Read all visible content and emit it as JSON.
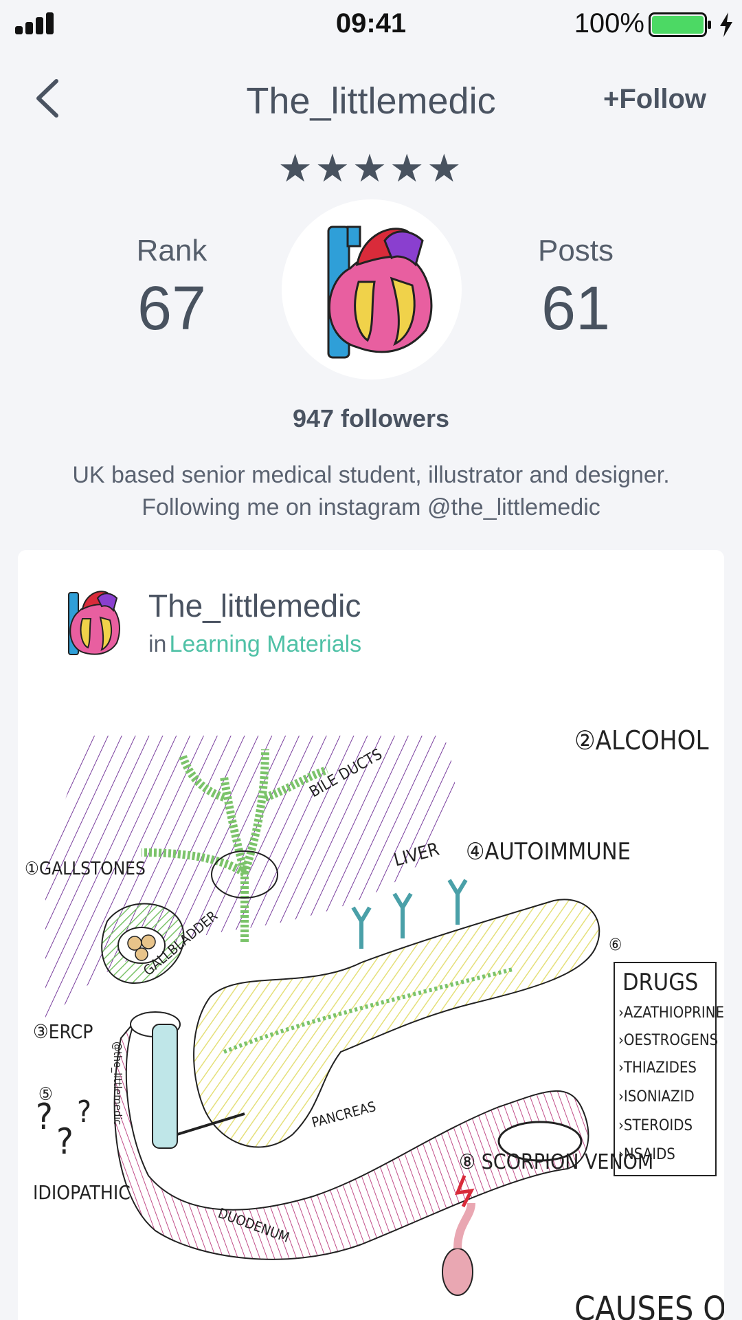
{
  "status_bar": {
    "time": "09:41",
    "battery": "100%",
    "battery_fill_fraction": 1.0,
    "battery_color": "#4cd964"
  },
  "header": {
    "title": "The_littlemedic",
    "follow_label": "+Follow",
    "back_icon": "chevron-left-icon"
  },
  "profile": {
    "stars": "★★★★★",
    "rating": 5,
    "rank_label": "Rank",
    "rank_value": "67",
    "posts_label": "Posts",
    "posts_value": "61",
    "followers": "947 followers",
    "bio": "UK based senior medical student, illustrator and designer. Following me on instagram @the_littlemedic"
  },
  "post": {
    "author": "The_littlemedic",
    "in_label": "in",
    "category": "Learning Materials",
    "category_color": "#4fc1a6",
    "illustration": {
      "causes": [
        "①GALLSTONES",
        "②ALCOHOL",
        "③ERCP",
        "④AUTOIMMUNE",
        "⑤",
        "IDIOPATHIC",
        "⑥",
        "⑧ SCORPION VENOM"
      ],
      "anatomy_labels": [
        "BILE DUCTS",
        "LIVER",
        "GALLBLADDER",
        "PANCREAS",
        "DUODENUM",
        "@the_littlemedic"
      ],
      "drugs_title": "DRUGS",
      "drugs": [
        "›AZATHIOPRINE",
        "›OESTROGENS",
        "›THIAZIDES",
        "›ISONIAZID",
        "›STEROIDS",
        "›NSAIDS"
      ],
      "banner": "CAUSES OF"
    }
  }
}
